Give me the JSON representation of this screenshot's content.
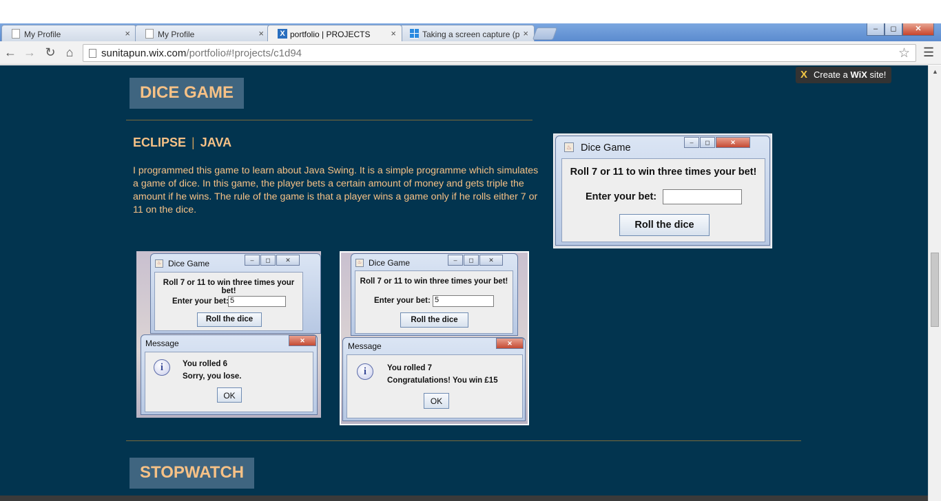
{
  "browser": {
    "tabs": [
      {
        "title": "My Profile",
        "active": false
      },
      {
        "title": "My Profile",
        "active": false
      },
      {
        "title": "portfolio | PROJECTS",
        "active": true
      },
      {
        "title": "Taking a screen capture (p",
        "active": false
      }
    ],
    "close_glyph": "×",
    "window_controls": {
      "minimize": "–",
      "maximize": "◻",
      "close": "✕"
    },
    "url_host": "sunitapun.wix.com",
    "url_path": "/portfolio#!projects/c1d94"
  },
  "wix_badge": {
    "prefix": "Create a ",
    "brand": "WiX",
    "suffix": " site!"
  },
  "project": {
    "title": "DICE GAME",
    "tags": [
      "ECLIPSE",
      "JAVA"
    ],
    "tag_separator": "|",
    "description": "I programmed this game to learn about Java Swing. It is a simple programme which simulates a game of dice. In this game, the player bets a certain amount of money and gets triple the amount if he wins. The rule of the game is that a player wins a game only if he rolls either 7 or 11 on the dice."
  },
  "dice_window": {
    "title": "Dice Game",
    "prompt": "Roll 7 or 11 to win three times your bet!",
    "bet_label": "Enter your bet:",
    "bet_value": "",
    "button": "Roll the dice"
  },
  "screenshot_lose": {
    "title": "Dice Game",
    "prompt": "Roll 7 or 11 to win three times your bet!",
    "bet_label": "Enter your bet:",
    "bet_value": "5",
    "button": "Roll the dice",
    "message_title": "Message",
    "line1": "You rolled 6",
    "line2": "Sorry, you lose.",
    "ok": "OK"
  },
  "screenshot_win": {
    "title": "Dice Game",
    "prompt": "Roll 7 or 11 to win three times your bet!",
    "bet_label": "Enter your bet:",
    "bet_value": "5",
    "button": "Roll the dice",
    "message_title": "Message",
    "line1": "You rolled 7",
    "line2": "Congratulations! You win £15",
    "ok": "OK"
  },
  "next_section": {
    "title": "STOPWATCH"
  },
  "colors": {
    "page_bg": "#02344f",
    "accent": "#f6c186",
    "heading_box": "#3f6580"
  }
}
